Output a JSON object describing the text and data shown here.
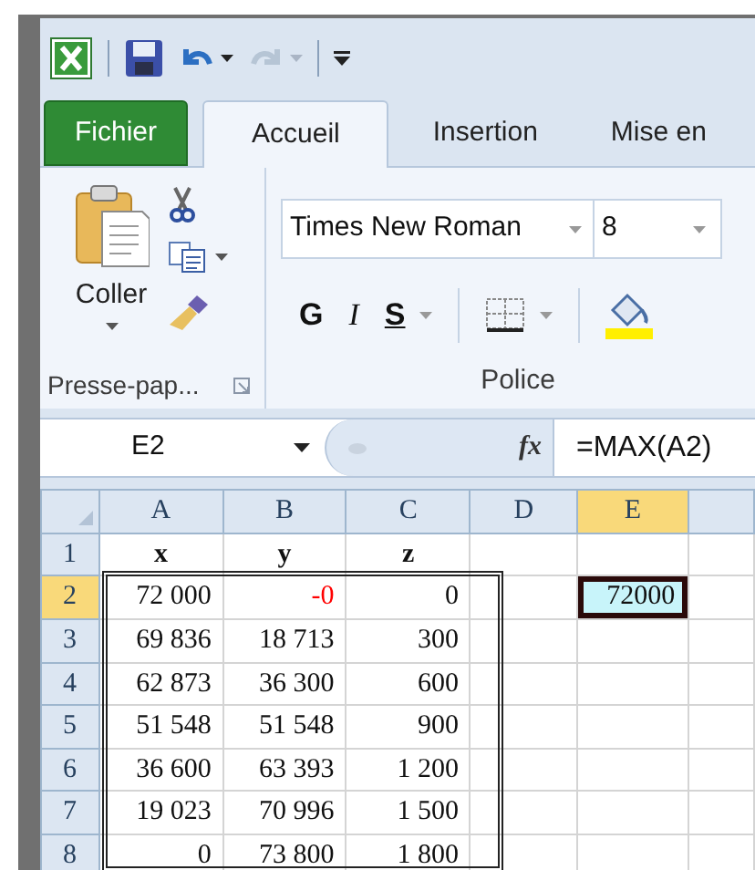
{
  "tabs": [
    {
      "label": "Fichier",
      "kind": "file",
      "selected": false
    },
    {
      "label": "Accueil",
      "kind": "tab",
      "selected": true
    },
    {
      "label": "Insertion",
      "kind": "tab",
      "selected": false
    },
    {
      "label": "Mise en",
      "kind": "tab",
      "selected": false
    }
  ],
  "clipboard": {
    "paste_label": "Coller",
    "group_label": "Presse-pap..."
  },
  "font": {
    "name": "Times New Roman",
    "size": "8",
    "bold": "G",
    "italic": "I",
    "underline": "S",
    "group_label": "Police"
  },
  "formula_bar": {
    "name_box": "E2",
    "fx": "fx",
    "formula": "=MAX(A2)"
  },
  "sheet": {
    "columns": [
      {
        "label": "A",
        "selected": false
      },
      {
        "label": "B",
        "selected": false
      },
      {
        "label": "C",
        "selected": false
      },
      {
        "label": "D",
        "selected": false
      },
      {
        "label": "E",
        "selected": true
      }
    ],
    "rows": [
      {
        "label": "1",
        "selected": false,
        "cells": [
          {
            "text": "x",
            "kind": "header"
          },
          {
            "text": "y",
            "kind": "header"
          },
          {
            "text": "z",
            "kind": "header"
          },
          null,
          null
        ]
      },
      {
        "label": "2",
        "selected": true,
        "cells": [
          {
            "text": "72 000",
            "kind": "number"
          },
          {
            "text": "-0",
            "kind": "negative"
          },
          {
            "text": "0",
            "kind": "number"
          },
          null,
          {
            "text": "72000",
            "kind": "active"
          }
        ]
      },
      {
        "label": "3",
        "selected": false,
        "cells": [
          {
            "text": "69 836",
            "kind": "number"
          },
          {
            "text": "18 713",
            "kind": "number"
          },
          {
            "text": "300",
            "kind": "number"
          },
          null,
          null
        ]
      },
      {
        "label": "4",
        "selected": false,
        "cells": [
          {
            "text": "62 873",
            "kind": "number"
          },
          {
            "text": "36 300",
            "kind": "number"
          },
          {
            "text": "600",
            "kind": "number"
          },
          null,
          null
        ]
      },
      {
        "label": "5",
        "selected": false,
        "cells": [
          {
            "text": "51 548",
            "kind": "number"
          },
          {
            "text": "51 548",
            "kind": "number"
          },
          {
            "text": "900",
            "kind": "number"
          },
          null,
          null
        ]
      },
      {
        "label": "6",
        "selected": false,
        "cells": [
          {
            "text": "36 600",
            "kind": "number"
          },
          {
            "text": "63 393",
            "kind": "number"
          },
          {
            "text": "1 200",
            "kind": "number"
          },
          null,
          null
        ]
      },
      {
        "label": "7",
        "selected": false,
        "cells": [
          {
            "text": "19 023",
            "kind": "number"
          },
          {
            "text": "70 996",
            "kind": "number"
          },
          {
            "text": "1 500",
            "kind": "number"
          },
          null,
          null
        ]
      },
      {
        "label": "8",
        "selected": false,
        "cells": [
          {
            "text": "0",
            "kind": "number"
          },
          {
            "text": "73 800",
            "kind": "number"
          },
          {
            "text": "1 800",
            "kind": "number"
          },
          null,
          null
        ]
      }
    ]
  }
}
